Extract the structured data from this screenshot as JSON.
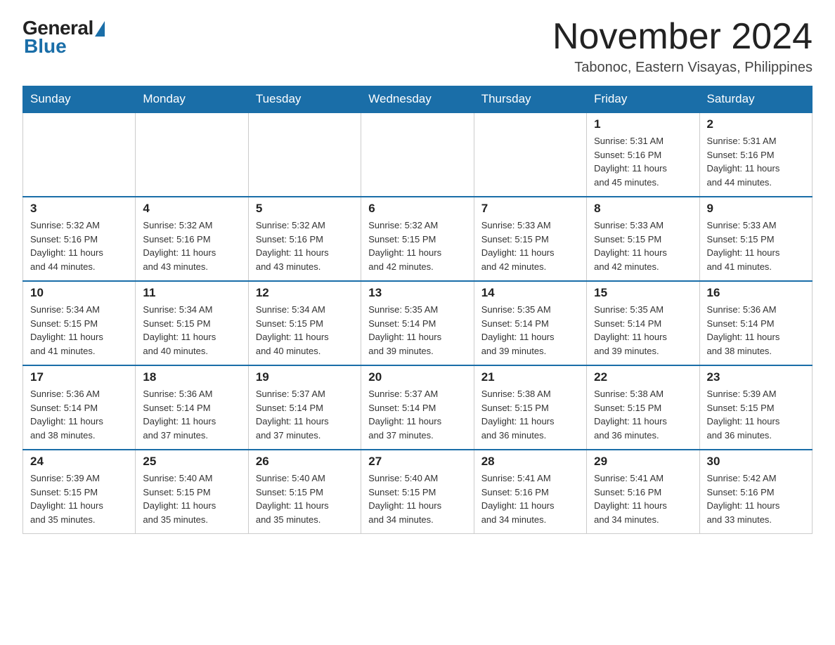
{
  "header": {
    "logo_general": "General",
    "logo_blue": "Blue",
    "month_title": "November 2024",
    "location": "Tabonoc, Eastern Visayas, Philippines"
  },
  "weekdays": [
    "Sunday",
    "Monday",
    "Tuesday",
    "Wednesday",
    "Thursday",
    "Friday",
    "Saturday"
  ],
  "weeks": [
    [
      {
        "day": "",
        "info": ""
      },
      {
        "day": "",
        "info": ""
      },
      {
        "day": "",
        "info": ""
      },
      {
        "day": "",
        "info": ""
      },
      {
        "day": "",
        "info": ""
      },
      {
        "day": "1",
        "info": "Sunrise: 5:31 AM\nSunset: 5:16 PM\nDaylight: 11 hours\nand 45 minutes."
      },
      {
        "day": "2",
        "info": "Sunrise: 5:31 AM\nSunset: 5:16 PM\nDaylight: 11 hours\nand 44 minutes."
      }
    ],
    [
      {
        "day": "3",
        "info": "Sunrise: 5:32 AM\nSunset: 5:16 PM\nDaylight: 11 hours\nand 44 minutes."
      },
      {
        "day": "4",
        "info": "Sunrise: 5:32 AM\nSunset: 5:16 PM\nDaylight: 11 hours\nand 43 minutes."
      },
      {
        "day": "5",
        "info": "Sunrise: 5:32 AM\nSunset: 5:16 PM\nDaylight: 11 hours\nand 43 minutes."
      },
      {
        "day": "6",
        "info": "Sunrise: 5:32 AM\nSunset: 5:15 PM\nDaylight: 11 hours\nand 42 minutes."
      },
      {
        "day": "7",
        "info": "Sunrise: 5:33 AM\nSunset: 5:15 PM\nDaylight: 11 hours\nand 42 minutes."
      },
      {
        "day": "8",
        "info": "Sunrise: 5:33 AM\nSunset: 5:15 PM\nDaylight: 11 hours\nand 42 minutes."
      },
      {
        "day": "9",
        "info": "Sunrise: 5:33 AM\nSunset: 5:15 PM\nDaylight: 11 hours\nand 41 minutes."
      }
    ],
    [
      {
        "day": "10",
        "info": "Sunrise: 5:34 AM\nSunset: 5:15 PM\nDaylight: 11 hours\nand 41 minutes."
      },
      {
        "day": "11",
        "info": "Sunrise: 5:34 AM\nSunset: 5:15 PM\nDaylight: 11 hours\nand 40 minutes."
      },
      {
        "day": "12",
        "info": "Sunrise: 5:34 AM\nSunset: 5:15 PM\nDaylight: 11 hours\nand 40 minutes."
      },
      {
        "day": "13",
        "info": "Sunrise: 5:35 AM\nSunset: 5:14 PM\nDaylight: 11 hours\nand 39 minutes."
      },
      {
        "day": "14",
        "info": "Sunrise: 5:35 AM\nSunset: 5:14 PM\nDaylight: 11 hours\nand 39 minutes."
      },
      {
        "day": "15",
        "info": "Sunrise: 5:35 AM\nSunset: 5:14 PM\nDaylight: 11 hours\nand 39 minutes."
      },
      {
        "day": "16",
        "info": "Sunrise: 5:36 AM\nSunset: 5:14 PM\nDaylight: 11 hours\nand 38 minutes."
      }
    ],
    [
      {
        "day": "17",
        "info": "Sunrise: 5:36 AM\nSunset: 5:14 PM\nDaylight: 11 hours\nand 38 minutes."
      },
      {
        "day": "18",
        "info": "Sunrise: 5:36 AM\nSunset: 5:14 PM\nDaylight: 11 hours\nand 37 minutes."
      },
      {
        "day": "19",
        "info": "Sunrise: 5:37 AM\nSunset: 5:14 PM\nDaylight: 11 hours\nand 37 minutes."
      },
      {
        "day": "20",
        "info": "Sunrise: 5:37 AM\nSunset: 5:14 PM\nDaylight: 11 hours\nand 37 minutes."
      },
      {
        "day": "21",
        "info": "Sunrise: 5:38 AM\nSunset: 5:15 PM\nDaylight: 11 hours\nand 36 minutes."
      },
      {
        "day": "22",
        "info": "Sunrise: 5:38 AM\nSunset: 5:15 PM\nDaylight: 11 hours\nand 36 minutes."
      },
      {
        "day": "23",
        "info": "Sunrise: 5:39 AM\nSunset: 5:15 PM\nDaylight: 11 hours\nand 36 minutes."
      }
    ],
    [
      {
        "day": "24",
        "info": "Sunrise: 5:39 AM\nSunset: 5:15 PM\nDaylight: 11 hours\nand 35 minutes."
      },
      {
        "day": "25",
        "info": "Sunrise: 5:40 AM\nSunset: 5:15 PM\nDaylight: 11 hours\nand 35 minutes."
      },
      {
        "day": "26",
        "info": "Sunrise: 5:40 AM\nSunset: 5:15 PM\nDaylight: 11 hours\nand 35 minutes."
      },
      {
        "day": "27",
        "info": "Sunrise: 5:40 AM\nSunset: 5:15 PM\nDaylight: 11 hours\nand 34 minutes."
      },
      {
        "day": "28",
        "info": "Sunrise: 5:41 AM\nSunset: 5:16 PM\nDaylight: 11 hours\nand 34 minutes."
      },
      {
        "day": "29",
        "info": "Sunrise: 5:41 AM\nSunset: 5:16 PM\nDaylight: 11 hours\nand 34 minutes."
      },
      {
        "day": "30",
        "info": "Sunrise: 5:42 AM\nSunset: 5:16 PM\nDaylight: 11 hours\nand 33 minutes."
      }
    ]
  ]
}
